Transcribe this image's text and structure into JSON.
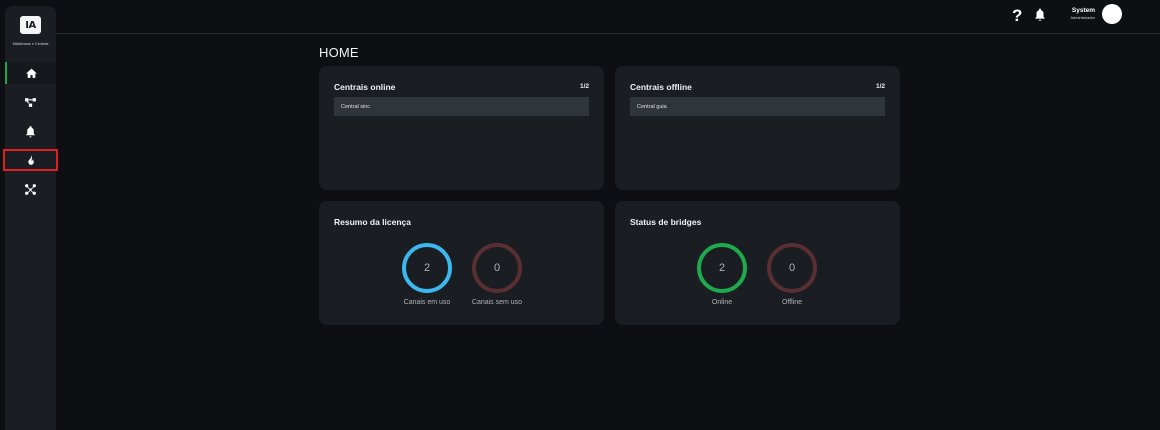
{
  "sidebar": {
    "logo_text": "IA",
    "logo_caption": "Middleware e Centrais",
    "items": [
      {
        "name": "home-icon"
      },
      {
        "name": "network-icon"
      },
      {
        "name": "bell-icon"
      },
      {
        "name": "fire-icon"
      },
      {
        "name": "drone-icon"
      }
    ]
  },
  "topbar": {
    "help_label": "?",
    "user_name": "System",
    "user_role": "Administrador"
  },
  "page": {
    "title": "HOME"
  },
  "cards": {
    "online": {
      "title": "Centrais online",
      "count": "1/2",
      "items": [
        "Central sinc"
      ]
    },
    "offline": {
      "title": "Centrais offline",
      "count": "1/2",
      "items": [
        "Central guia"
      ]
    },
    "license": {
      "title": "Resumo da licença",
      "rings": [
        {
          "value": "2",
          "label": "Canais em uso",
          "color": "#3cb8ee"
        },
        {
          "value": "0",
          "label": "Canais sem uso",
          "color": "#5a2f33"
        }
      ]
    },
    "bridges": {
      "title": "Status de bridges",
      "rings": [
        {
          "value": "2",
          "label": "Online",
          "color": "#1ea94d"
        },
        {
          "value": "0",
          "label": "Offline",
          "color": "#5a2f33"
        }
      ]
    }
  }
}
